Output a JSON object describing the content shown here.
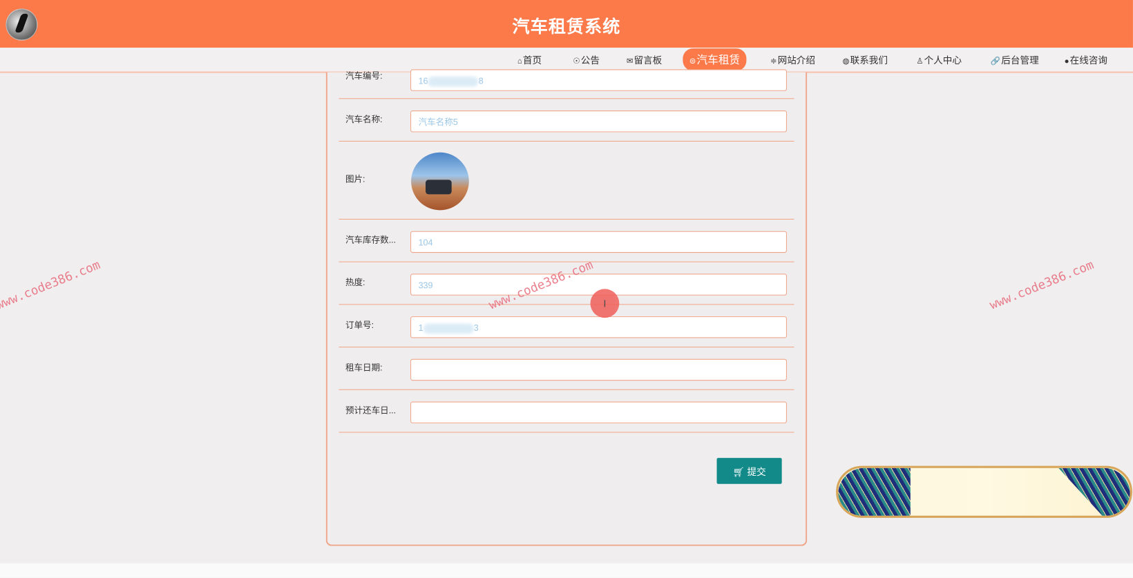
{
  "header": {
    "title": "汽车租赁系统"
  },
  "nav": [
    {
      "icon": "home-icon",
      "glyph": "⌂",
      "label": "首页"
    },
    {
      "icon": "bell-icon",
      "glyph": "☉",
      "label": "公告"
    },
    {
      "icon": "mail-icon",
      "glyph": "✉",
      "label": "留言板"
    },
    {
      "icon": "car-icon",
      "glyph": "⊜",
      "label": "汽车租赁",
      "active": true
    },
    {
      "icon": "menu-icon",
      "glyph": "≑",
      "label": "网站介绍"
    },
    {
      "icon": "globe-icon",
      "glyph": "◍",
      "label": "联系我们"
    },
    {
      "icon": "user-icon",
      "glyph": "♙",
      "label": "个人中心"
    },
    {
      "icon": "link-icon",
      "glyph": "🔗",
      "label": "后台管理"
    },
    {
      "icon": "chat-icon",
      "glyph": "●",
      "label": "在线咨询"
    }
  ],
  "form": {
    "car_no": {
      "label": "汽车编号:",
      "value_start": "16",
      "value_end": "8"
    },
    "car_name": {
      "label": "汽车名称:",
      "value": "汽车名称5"
    },
    "image": {
      "label": "图片:"
    },
    "stock": {
      "label": "汽车库存数...",
      "value": "104"
    },
    "heat": {
      "label": "热度:",
      "value": "339"
    },
    "order_no": {
      "label": "订单号:",
      "value_start": "1",
      "value_end": "3"
    },
    "rent_date": {
      "label": "租车日期:",
      "value": ""
    },
    "return_date": {
      "label": "预计还车日...",
      "value": ""
    },
    "submit_label": "提交"
  },
  "watermark": "www.code386.com",
  "cursor_glyph": "I",
  "colors": {
    "accent": "#fc7a4a",
    "submit": "#138a8a"
  }
}
